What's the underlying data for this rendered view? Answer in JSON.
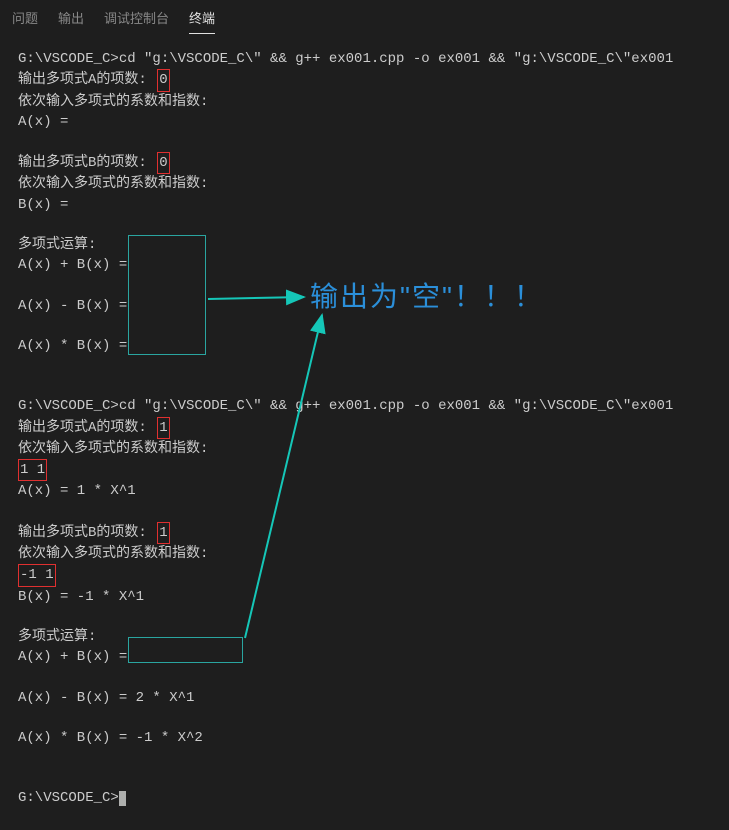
{
  "tabs": {
    "problems": "问题",
    "output": "输出",
    "debug_console": "调试控制台",
    "terminal": "终端"
  },
  "terminal": {
    "cmd1": "G:\\VSCODE_C>cd \"g:\\VSCODE_C\\\" && g++ ex001.cpp -o ex001 && \"g:\\VSCODE_C\\\"ex001",
    "promptA_count_label": "输出多项式A的项数:",
    "promptA_count_value": "0",
    "prompt_coef_exp": "依次输入多项式的系数和指数:",
    "Ax_eq": "A(x) = ",
    "promptB_count_label": "输出多项式B的项数:",
    "promptB_count_value": "0",
    "Bx_eq": "B(x) = ",
    "poly_calc": "多项式运算:",
    "A_plus_B": "A(x) + B(x) = ",
    "A_minus_B": "A(x) - B(x) = ",
    "A_times_B": "A(x) * B(x) = ",
    "cmd2": "G:\\VSCODE_C>cd \"g:\\VSCODE_C\\\" && g++ ex001.cpp -o ex001 && \"g:\\VSCODE_C\\\"ex001",
    "promptA_count_value2": "1",
    "inputA2": "1 1",
    "Ax_result2": "A(x) = 1 * X^1",
    "promptB_count_value2": "1",
    "inputB2": "-1 1",
    "Bx_result2": "B(x) = -1 * X^1",
    "A_plus_B_result2": "A(x) + B(x) = ",
    "A_minus_B_result2": "A(x) - B(x) = 2 * X^1",
    "A_times_B_result2": "A(x) * B(x) = -1 * X^2",
    "final_prompt": "G:\\VSCODE_C>"
  },
  "annotation": {
    "text": "输出为\"空\"！！！"
  }
}
